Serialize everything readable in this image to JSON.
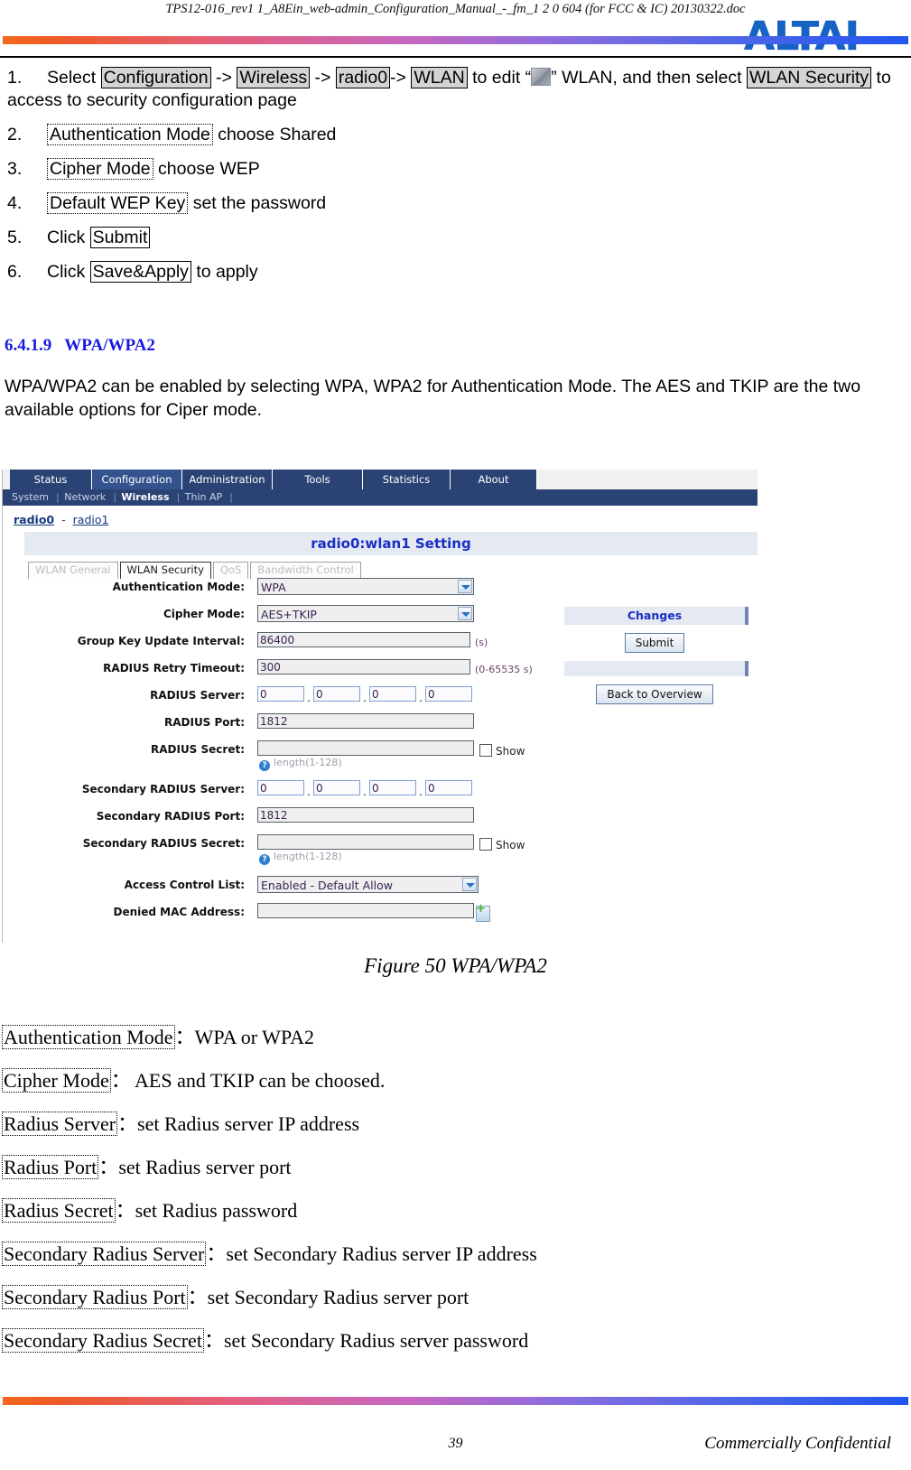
{
  "header": {
    "doc_title": "TPS12-016_rev1 1_A8Ein_web-admin_Configuration_Manual_-_fm_1 2 0 604 (for FCC & IC) 20130322.doc",
    "logo_text": "ALTAI"
  },
  "steps": [
    {
      "num": "1.",
      "parts": [
        {
          "t": "text",
          "v": "Select "
        },
        {
          "t": "hl",
          "v": "Configuration"
        },
        {
          "t": "text",
          "v": " -> "
        },
        {
          "t": "hl",
          "v": "Wireless"
        },
        {
          "t": "text",
          "v": " -> "
        },
        {
          "t": "hl",
          "v": "radio0"
        },
        {
          "t": "text",
          "v": "-> "
        },
        {
          "t": "hl",
          "v": "WLAN"
        },
        {
          "t": "text",
          "v": " to edit  “"
        },
        {
          "t": "icon",
          "v": "wlan-thumb-icon"
        },
        {
          "t": "text",
          "v": "”  WLAN, and then select "
        },
        {
          "t": "hl",
          "v": "WLAN Security"
        },
        {
          "t": "text",
          "v": " to access to security configuration page"
        }
      ]
    },
    {
      "num": "2.",
      "parts": [
        {
          "t": "dot",
          "v": "Authentication Mode"
        },
        {
          "t": "text",
          "v": " choose Shared"
        }
      ]
    },
    {
      "num": "3.",
      "parts": [
        {
          "t": "dot",
          "v": "Cipher Mode"
        },
        {
          "t": "text",
          "v": " choose WEP"
        }
      ]
    },
    {
      "num": "4.",
      "parts": [
        {
          "t": "dot",
          "v": "Default WEP Key"
        },
        {
          "t": "text",
          "v": " set the password"
        }
      ]
    },
    {
      "num": "5.",
      "parts": [
        {
          "t": "text",
          "v": "Click "
        },
        {
          "t": "box",
          "v": "Submit"
        }
      ]
    },
    {
      "num": "6.",
      "parts": [
        {
          "t": "text",
          "v": "Click "
        },
        {
          "t": "box",
          "v": "Save&Apply"
        },
        {
          "t": "text",
          "v": " to apply"
        }
      ]
    }
  ],
  "section": {
    "number": "6.4.1.9",
    "title": "WPA/WPA2",
    "paragraph": "WPA/WPA2 can be enabled by selecting WPA, WPA2 for Authentication Mode. The AES and TKIP are the two available options for Ciper mode."
  },
  "webui": {
    "top_tabs": [
      {
        "label": "Status",
        "active": false
      },
      {
        "label": "Configuration",
        "active": true
      },
      {
        "label": "Administration",
        "active": false
      },
      {
        "label": "Tools",
        "active": false
      },
      {
        "label": "Statistics",
        "active": false
      },
      {
        "label": "About",
        "active": false
      }
    ],
    "sub_tabs": [
      {
        "label": "System",
        "active": false
      },
      {
        "label": "Network",
        "active": false
      },
      {
        "label": "Wireless",
        "active": true
      },
      {
        "label": "Thin AP",
        "active": false
      }
    ],
    "radio_links": {
      "current": "radio0",
      "dash": "-",
      "other": "radio1"
    },
    "panel_title": "radio0:wlan1 Setting",
    "page_tabs": [
      {
        "label": "WLAN General",
        "active": false
      },
      {
        "label": "WLAN Security",
        "active": true
      },
      {
        "label": "QoS",
        "active": false
      },
      {
        "label": "Bandwidth Control",
        "active": false
      }
    ],
    "fields": {
      "auth_mode_label": "Authentication Mode:",
      "auth_mode_value": "WPA",
      "cipher_mode_label": "Cipher Mode:",
      "cipher_mode_value": "AES+TKIP",
      "group_key_label": "Group Key Update Interval:",
      "group_key_value": "86400",
      "group_key_unit": "(s)",
      "radius_retry_label": "RADIUS Retry Timeout:",
      "radius_retry_value": "300",
      "radius_retry_unit": "(0-65535 s)",
      "radius_server_label": "RADIUS Server:",
      "radius_server_octets": [
        "0",
        "0",
        "0",
        "0"
      ],
      "radius_port_label": "RADIUS Port:",
      "radius_port_value": "1812",
      "radius_secret_label": "RADIUS Secret:",
      "radius_secret_value": "",
      "radius_secret_show": "Show",
      "radius_secret_hint": "length(1-128)",
      "sec_radius_server_label": "Secondary RADIUS Server:",
      "sec_radius_server_octets": [
        "0",
        "0",
        "0",
        "0"
      ],
      "sec_radius_port_label": "Secondary RADIUS Port:",
      "sec_radius_port_value": "1812",
      "sec_radius_secret_label": "Secondary RADIUS Secret:",
      "sec_radius_secret_value": "",
      "sec_radius_secret_show": "Show",
      "sec_radius_secret_hint": "length(1-128)",
      "acl_label": "Access Control List:",
      "acl_value": "Enabled - Default Allow",
      "denied_mac_label": "Denied MAC Address:",
      "denied_mac_value": ""
    },
    "changes": {
      "title": "Changes",
      "submit_label": "Submit",
      "back_label": "Back to Overview"
    }
  },
  "figure_caption": "Figure 50 WPA/WPA2",
  "definitions": [
    {
      "term": "Authentication Mode",
      "sep": "：",
      "desc": "WPA or WPA2"
    },
    {
      "term": "Cipher Mode",
      "sep": "：",
      "desc": " AES and TKIP can be choosed."
    },
    {
      "term": "Radius Server",
      "sep": "：",
      "desc": "set Radius server IP address"
    },
    {
      "term": "Radius Port",
      "sep": "：",
      "desc": "set Radius server port"
    },
    {
      "term": "Radius Secret",
      "sep": "：",
      "desc": "set Radius password"
    },
    {
      "term": "Secondary Radius Server",
      "sep": "：",
      "desc": "set Secondary Radius server IP address"
    },
    {
      "term": "Secondary Radius Port",
      "sep": "：",
      "desc": "set Secondary Radius server port"
    },
    {
      "term": "Secondary Radius Secret",
      "sep": "：",
      "desc": "set Secondary Radius server password"
    }
  ],
  "footer": {
    "page_number": "39",
    "confidential": "Commercially Confidential"
  }
}
